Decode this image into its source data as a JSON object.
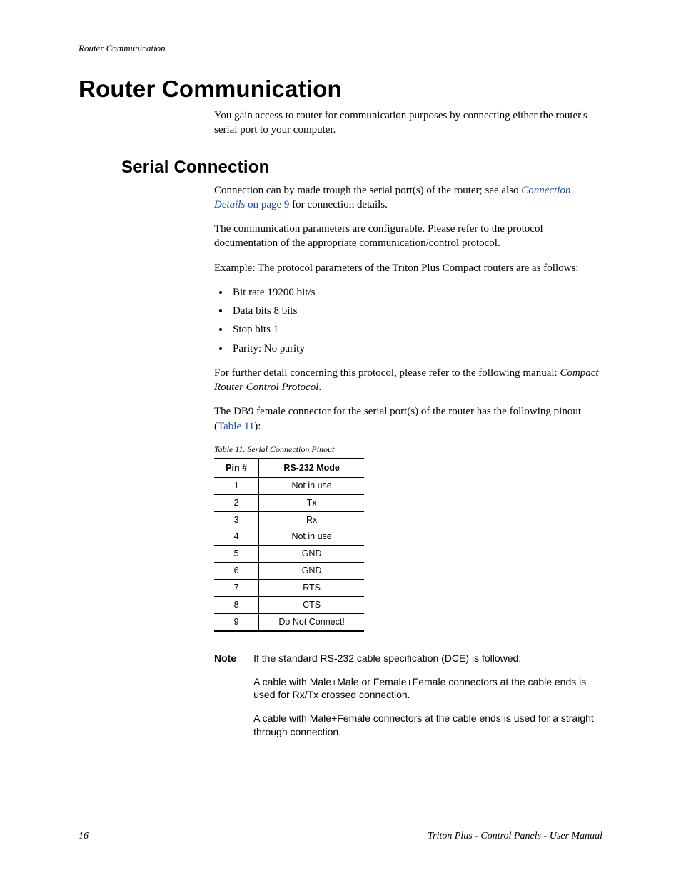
{
  "running_head": "Router Communication",
  "section": {
    "title": "Router Communication",
    "intro": "You gain access to router for communication purposes by connecting either the router's serial port to your computer."
  },
  "subsection": {
    "title": "Serial Connection",
    "p1_pre": "Connection can by made trough the serial port(s) of the router; see also ",
    "p1_link": "Connection Details",
    "p1_link_tail": " on page 9",
    "p1_post": " for connection details.",
    "p2": "The communication parameters are configurable. Please refer to the protocol documentation of the appropriate communication/control protocol.",
    "p3": "Example: The protocol parameters of the Triton Plus Compact routers are as follows:",
    "bullets": [
      "Bit rate 19200 bit/s",
      "Data bits 8 bits",
      "Stop bits 1",
      "Parity: No parity"
    ],
    "p4_pre": "For further detail concerning this protocol, please refer to the following manual: ",
    "p4_em": "Compact Router Control Protocol",
    "p4_post": ".",
    "p5_pre": "The DB9 female connector for the serial port(s) of the router has the following pinout (",
    "p5_link": "Table 11",
    "p5_post": "):"
  },
  "table": {
    "caption": "Table 11.  Serial Connection Pinout",
    "head_pin": "Pin #",
    "head_mode": "RS-232 Mode",
    "rows": [
      {
        "pin": "1",
        "mode": "Not in use"
      },
      {
        "pin": "2",
        "mode": "Tx"
      },
      {
        "pin": "3",
        "mode": "Rx"
      },
      {
        "pin": "4",
        "mode": "Not in use"
      },
      {
        "pin": "5",
        "mode": "GND"
      },
      {
        "pin": "6",
        "mode": "GND"
      },
      {
        "pin": "7",
        "mode": "RTS"
      },
      {
        "pin": "8",
        "mode": "CTS"
      },
      {
        "pin": "9",
        "mode": "Do Not Connect!"
      }
    ]
  },
  "note": {
    "label": "Note",
    "p1": "If the standard RS-232 cable specification (DCE) is followed:",
    "p2": "A cable with Male+Male or Female+Female connectors at the cable ends is used for Rx/Tx crossed connection.",
    "p3": "A cable with Male+Female connectors at the cable ends is used for a straight through connection."
  },
  "footer": {
    "page": "16",
    "doc": "Triton Plus - Control Panels - User Manual"
  }
}
